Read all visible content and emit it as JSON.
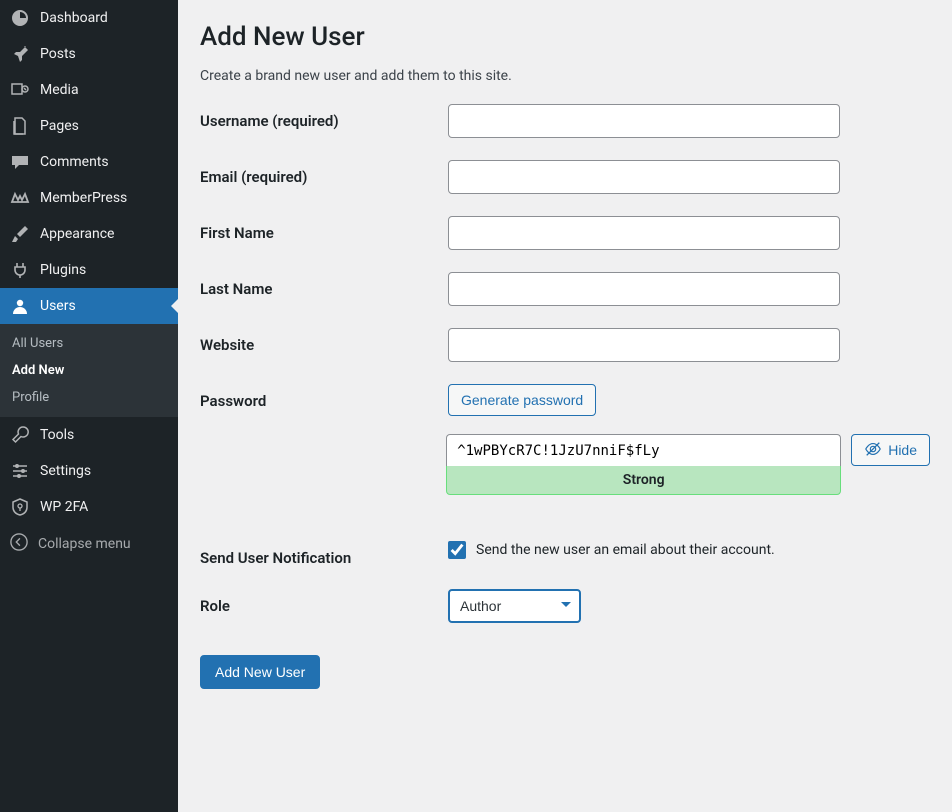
{
  "sidebar": {
    "items": [
      {
        "key": "dashboard",
        "label": "Dashboard",
        "icon": "dashboard-icon"
      },
      {
        "key": "posts",
        "label": "Posts",
        "icon": "pin-icon"
      },
      {
        "key": "media",
        "label": "Media",
        "icon": "media-icon"
      },
      {
        "key": "pages",
        "label": "Pages",
        "icon": "pages-icon"
      },
      {
        "key": "comments",
        "label": "Comments",
        "icon": "comment-icon"
      },
      {
        "key": "memberpress",
        "label": "MemberPress",
        "icon": "memberpress-icon"
      },
      {
        "key": "appearance",
        "label": "Appearance",
        "icon": "brush-icon"
      },
      {
        "key": "plugins",
        "label": "Plugins",
        "icon": "plug-icon"
      },
      {
        "key": "users",
        "label": "Users",
        "icon": "user-icon",
        "current": true,
        "submenu": [
          {
            "key": "all-users",
            "label": "All Users"
          },
          {
            "key": "add-new",
            "label": "Add New",
            "current": true
          },
          {
            "key": "profile",
            "label": "Profile"
          }
        ]
      },
      {
        "key": "tools",
        "label": "Tools",
        "icon": "wrench-icon"
      },
      {
        "key": "settings",
        "label": "Settings",
        "icon": "sliders-icon"
      },
      {
        "key": "wp2fa",
        "label": "WP 2FA",
        "icon": "shield-icon"
      }
    ],
    "collapse_label": "Collapse menu"
  },
  "page": {
    "title": "Add New User",
    "description": "Create a brand new user and add them to this site."
  },
  "form": {
    "username_label": "Username (required)",
    "username_value": "",
    "email_label": "Email (required)",
    "email_value": "",
    "firstname_label": "First Name",
    "firstname_value": "",
    "lastname_label": "Last Name",
    "lastname_value": "",
    "website_label": "Website",
    "website_value": "",
    "password_label": "Password",
    "generate_password_label": "Generate password",
    "password_value": "^1wPBYcR7C!1JzU7nniF$fLy",
    "password_strength": "Strong",
    "hide_label": "Hide",
    "notification_label": "Send User Notification",
    "notification_text": "Send the new user an email about their account.",
    "notification_checked": true,
    "role_label": "Role",
    "role_selected": "Author",
    "submit_label": "Add New User"
  }
}
